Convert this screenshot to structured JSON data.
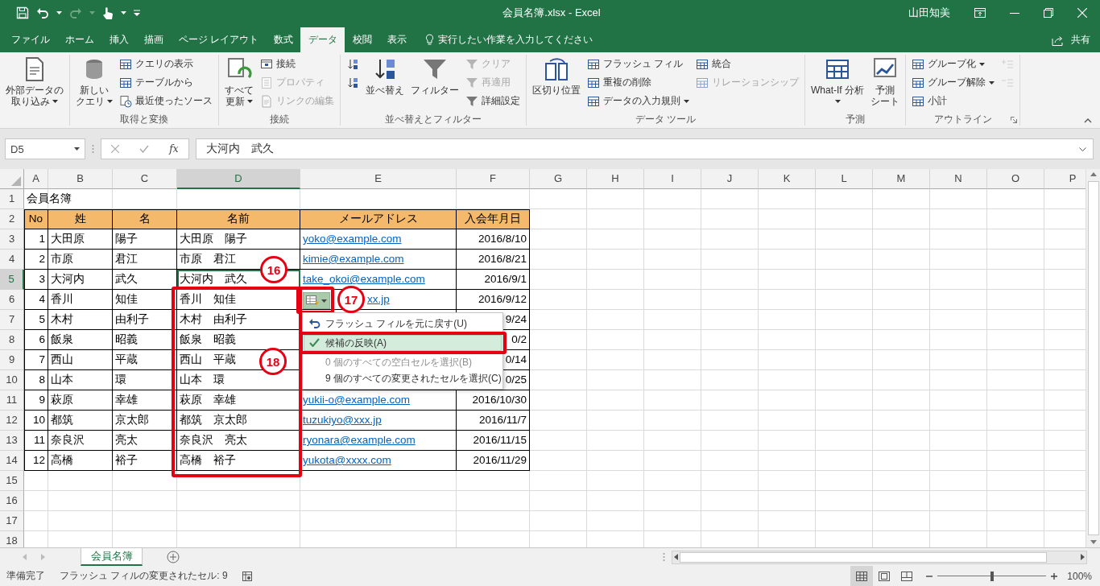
{
  "window": {
    "title": "会員名簿.xlsx - Excel",
    "user": "山田知美"
  },
  "tabs": [
    {
      "label": "ファイル",
      "selected": false
    },
    {
      "label": "ホーム",
      "selected": false
    },
    {
      "label": "挿入",
      "selected": false
    },
    {
      "label": "描画",
      "selected": false
    },
    {
      "label": "ページ レイアウト",
      "selected": false
    },
    {
      "label": "数式",
      "selected": false
    },
    {
      "label": "データ",
      "selected": true
    },
    {
      "label": "校閲",
      "selected": false
    },
    {
      "label": "表示",
      "selected": false
    }
  ],
  "tell_me": "実行したい作業を入力してください",
  "share": "共有",
  "ribbon_groups": [
    {
      "items": [
        {
          "kind": "large",
          "lines": [
            "外部データの",
            "取り込み"
          ],
          "dropdown": true
        }
      ]
    },
    {
      "label": "取得と変換",
      "items": [
        {
          "kind": "large",
          "lines": [
            "新しい",
            "クエリ"
          ],
          "dropdown": true
        },
        {
          "kind": "stack",
          "buttons": [
            {
              "label": "クエリの表示",
              "disabled": false
            },
            {
              "label": "テーブルから",
              "disabled": false
            },
            {
              "label": "最近使ったソース",
              "disabled": false
            }
          ]
        }
      ]
    },
    {
      "label": "接続",
      "items": [
        {
          "kind": "large",
          "lines": [
            "すべて",
            "更新"
          ],
          "dropdown": true
        },
        {
          "kind": "stack",
          "buttons": [
            {
              "label": "接続",
              "disabled": false
            },
            {
              "label": "プロパティ",
              "disabled": true
            },
            {
              "label": "リンクの編集",
              "disabled": true
            }
          ]
        }
      ]
    },
    {
      "label": "並べ替えとフィルター",
      "items": [
        {
          "kind": "stack",
          "buttons": [
            {
              "disabled": false
            },
            {
              "disabled": false
            }
          ]
        },
        {
          "kind": "large",
          "lines": [
            "並べ替え"
          ],
          "dropdown": false
        },
        {
          "kind": "large",
          "lines": [
            "フィルター"
          ],
          "dropdown": false
        },
        {
          "kind": "stack",
          "buttons": [
            {
              "label": "クリア",
              "disabled": true
            },
            {
              "label": "再適用",
              "disabled": true
            },
            {
              "label": "詳細設定",
              "disabled": false
            }
          ]
        }
      ]
    },
    {
      "label": "データ ツール",
      "items": [
        {
          "kind": "large",
          "lines": [
            "区切り位置"
          ],
          "dropdown": false
        },
        {
          "kind": "stack",
          "buttons": [
            {
              "label": "フラッシュ フィル",
              "disabled": false
            },
            {
              "label": "重複の削除",
              "disabled": false
            },
            {
              "label": "データの入力規則",
              "disabled": false,
              "dropdown": true
            }
          ]
        },
        {
          "kind": "stack",
          "buttons": [
            {
              "label": "統合",
              "disabled": false
            },
            {
              "label": "リレーションシップ",
              "disabled": true
            }
          ]
        }
      ]
    },
    {
      "label": "予測",
      "items": [
        {
          "kind": "large",
          "lines": [
            "What-If 分析"
          ],
          "dropdown": true
        },
        {
          "kind": "large",
          "lines": [
            "予測",
            "シート"
          ],
          "dropdown": false
        }
      ]
    },
    {
      "label": "アウトライン",
      "launcher": true,
      "items": [
        {
          "kind": "stack",
          "buttons": [
            {
              "label": "グループ化",
              "disabled": false,
              "dropdown": true
            },
            {
              "label": "グループ解除",
              "disabled": false,
              "dropdown": true
            },
            {
              "label": "小計",
              "disabled": false
            }
          ]
        },
        {
          "kind": "stack",
          "buttons": [
            {
              "disabled": true
            },
            {
              "disabled": true
            }
          ]
        }
      ]
    }
  ],
  "formula_bar": {
    "name_box": "D5",
    "function_label": "fx",
    "formula": "大河内　武久"
  },
  "grid": {
    "columns": [
      {
        "label": "A",
        "selected": false
      },
      {
        "label": "B",
        "selected": false
      },
      {
        "label": "C",
        "selected": false
      },
      {
        "label": "D",
        "selected": true
      },
      {
        "label": "E",
        "selected": false
      },
      {
        "label": "F",
        "selected": false
      },
      {
        "label": "G",
        "selected": false
      },
      {
        "label": "H",
        "selected": false
      },
      {
        "label": "I",
        "selected": false
      },
      {
        "label": "J",
        "selected": false
      },
      {
        "label": "K",
        "selected": false
      },
      {
        "label": "L",
        "selected": false
      },
      {
        "label": "M",
        "selected": false
      },
      {
        "label": "N",
        "selected": false
      },
      {
        "label": "O",
        "selected": false
      },
      {
        "label": "P",
        "selected": false
      }
    ],
    "rows": [
      {
        "header": "1",
        "selected": false,
        "kind": "title",
        "cells": [
          "会員名簿"
        ]
      },
      {
        "header": "2",
        "selected": false,
        "kind": "header",
        "cells": [
          "No",
          "姓",
          "名",
          "名前",
          "メールアドレス",
          "入会年月日"
        ]
      },
      {
        "header": "3",
        "selected": false,
        "kind": "record",
        "cells": [
          "1",
          "大田原",
          "陽子",
          "大田原　陽子",
          "yoko@example.com",
          "2016/8/10"
        ]
      },
      {
        "header": "4",
        "selected": false,
        "kind": "record",
        "cells": [
          "2",
          "市原",
          "君江",
          "市原　君江",
          "kimie@example.com",
          "2016/8/21"
        ]
      },
      {
        "header": "5",
        "selected": true,
        "kind": "record",
        "cells": [
          "3",
          "大河内",
          "武久",
          "大河内　武久",
          "take_okoi@example.com",
          "2016/9/1"
        ]
      },
      {
        "header": "6",
        "selected": false,
        "kind": "record",
        "cells": [
          "4",
          "香川",
          "知佳",
          "香川　知佳",
          "xx.jp",
          "2016/9/12"
        ]
      },
      {
        "header": "7",
        "selected": false,
        "kind": "record",
        "cells": [
          "5",
          "木村",
          "由利子",
          "木村　由利子",
          null,
          "9/24"
        ]
      },
      {
        "header": "8",
        "selected": false,
        "kind": "record",
        "cells": [
          "6",
          "飯泉",
          "昭義",
          "飯泉　昭義",
          null,
          "0/2"
        ]
      },
      {
        "header": "9",
        "selected": false,
        "kind": "record",
        "cells": [
          "7",
          "西山",
          "平蔵",
          "西山　平蔵",
          null,
          "0/14"
        ]
      },
      {
        "header": "10",
        "selected": false,
        "kind": "record",
        "cells": [
          "8",
          "山本",
          "環",
          "山本　環",
          null,
          "0/25"
        ]
      },
      {
        "header": "11",
        "selected": false,
        "kind": "record",
        "cells": [
          "9",
          "萩原",
          "幸雄",
          "萩原　幸雄",
          "yukii-o@example.com",
          "2016/10/30"
        ]
      },
      {
        "header": "12",
        "selected": false,
        "kind": "record",
        "cells": [
          "10",
          "都筑",
          "京太郎",
          "都筑　京太郎",
          "tuzukiyo@xxx.jp",
          "2016/11/7"
        ]
      },
      {
        "header": "13",
        "selected": false,
        "kind": "record",
        "cells": [
          "11",
          "奈良沢",
          "亮太",
          "奈良沢　亮太",
          "ryonara@example.com",
          "2016/11/15"
        ]
      },
      {
        "header": "14",
        "selected": false,
        "kind": "record",
        "cells": [
          "12",
          "高橋",
          "裕子",
          "高橋　裕子",
          "yukota@xxxx.com",
          "2016/11/29"
        ]
      },
      {
        "header": "15",
        "selected": false,
        "kind": "empty"
      },
      {
        "header": "16",
        "selected": false,
        "kind": "empty"
      },
      {
        "header": "17",
        "selected": false,
        "kind": "empty"
      },
      {
        "header": "18",
        "selected": false,
        "kind": "empty"
      }
    ]
  },
  "flash_fill_menu": {
    "items": [
      {
        "kind": "undo",
        "text": "フラッシュ フィルを元に戻す(U)",
        "selected": false,
        "disabled": false
      },
      {
        "kind": "check",
        "text": "候補の反映(A)",
        "selected": true,
        "disabled": false
      },
      {
        "kind": "plain",
        "text": "0 個のすべての空白セルを選択(B)",
        "selected": false,
        "disabled": true
      },
      {
        "kind": "plain",
        "text": "9 個のすべての変更されたセルを選択(C)",
        "selected": false,
        "disabled": false
      }
    ]
  },
  "callouts": [
    "16",
    "17",
    "18"
  ],
  "sheet_tabs": [
    {
      "label": "会員名簿",
      "selected": true
    }
  ],
  "status_bar": {
    "ready": "準備完了",
    "message": "フラッシュ フィルの変更されたセル: 9",
    "views": [
      {
        "kind": "normal",
        "selected": true
      },
      {
        "kind": "page_layout",
        "selected": false
      },
      {
        "kind": "page_break",
        "selected": false
      }
    ],
    "zoom": {
      "level": 0.5,
      "reading": "100%"
    }
  }
}
